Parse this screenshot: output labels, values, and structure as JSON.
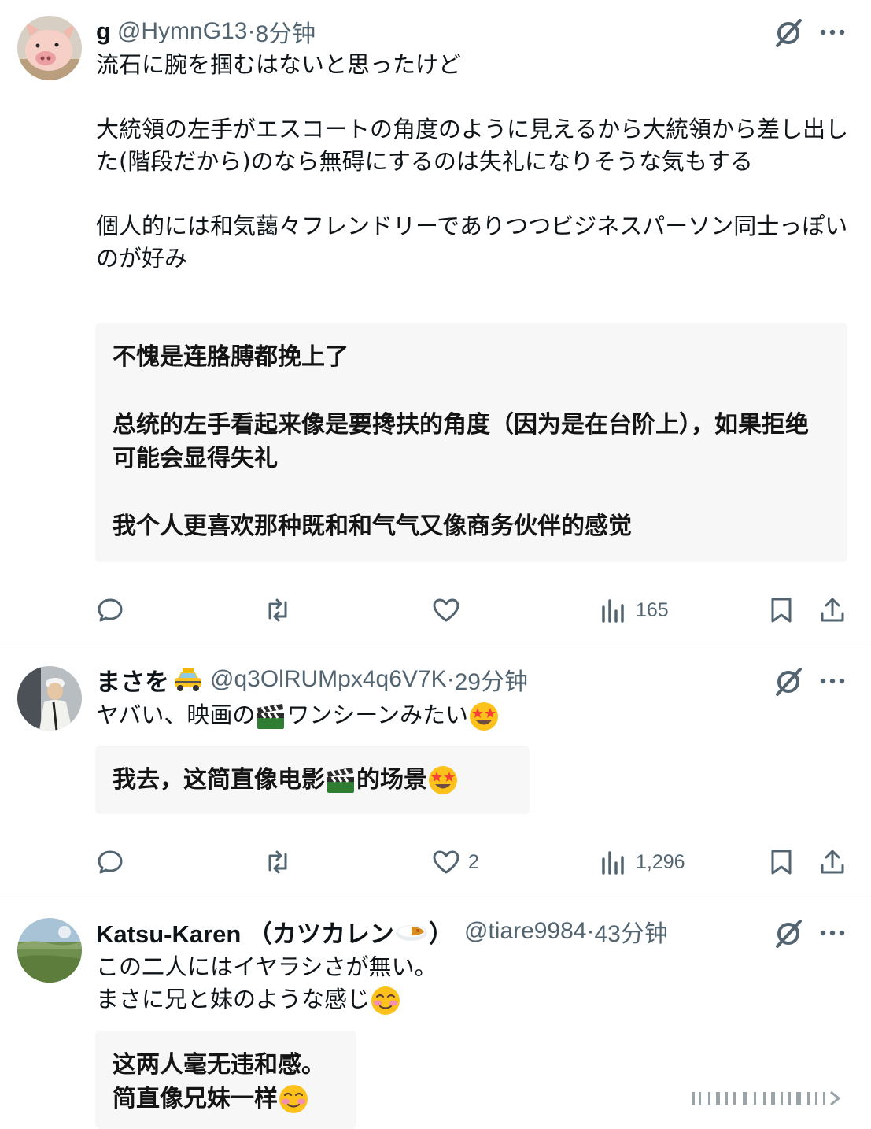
{
  "posts": [
    {
      "name": "g",
      "handle": "@HymnG13",
      "sep": " · ",
      "time": "8分钟",
      "text": [
        "流石に腕を掴むはないと思ったけど",
        "大統領の左手がエスコートの角度のように見えるから大統領から差し出した(階段だから)のなら無碍にするのは失礼になりそうな気もする",
        "個人的には和気藹々フレンドリーでありつつビジネスパーソン同士っぽいのが好み"
      ],
      "translation": [
        "不愧是连胳膊都挽上了",
        "总统的左手看起来像是要搀扶的角度（因为是在台阶上），如果拒绝可能会显得失礼",
        "我个人更喜欢那种既和和气气又像商务伙伴的感觉"
      ],
      "stats": {
        "replies": "",
        "reposts": "",
        "likes": "",
        "views": "165"
      }
    },
    {
      "name": "まさを",
      "handle": "@q3OlRUMpx4q6V7K",
      "sep": " · ",
      "time": "29分钟",
      "text_a": "ヤバい、映画の",
      "text_b": "ワンシーンみたい",
      "translation_a": "我去，这简直像电影 ",
      "translation_b": " 的场景 ",
      "stats": {
        "replies": "",
        "reposts": "",
        "likes": "2",
        "views": "1,296"
      }
    },
    {
      "name_a": "Katsu-Karen （カツカレン",
      "name_b": "）",
      "handle": "@tiare9984",
      "sep": " · ",
      "time": "43分钟",
      "text": [
        "この二人にはイヤラシさが無い。",
        "まさに兄と妹のような感じ"
      ],
      "translation": [
        "这两人毫无违和感。",
        "简直像兄妹一样 "
      ],
      "stats": {}
    }
  ],
  "icons": {
    "name_emoji_2": "taxi-emoji",
    "name_emoji_3": "curry-rice-emoji",
    "clapper": "clapper-board-emoji",
    "star_struck": "star-struck-emoji",
    "blush": "smiling-face-emoji"
  },
  "colors": {
    "text": "#0f1419",
    "muted": "#536471",
    "translation_bg": "#f7f7f8"
  }
}
